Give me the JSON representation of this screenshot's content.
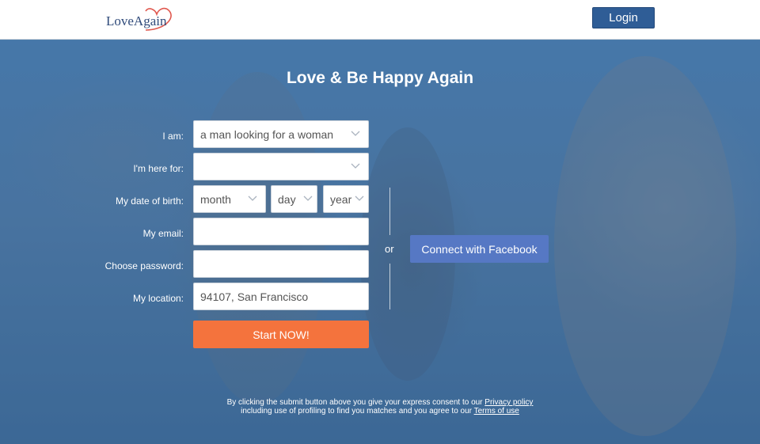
{
  "header": {
    "logo_text": "LoveAgain",
    "login_label": "Login"
  },
  "hero": {
    "headline": "Love & Be Happy Again"
  },
  "form": {
    "i_am": {
      "label": "I am:",
      "value": "a man looking for a woman"
    },
    "here_for": {
      "label": "I'm here for:",
      "value": ""
    },
    "dob": {
      "label": "My date of birth:",
      "month": "month",
      "day": "day",
      "year": "year"
    },
    "email": {
      "label": "My email:",
      "value": ""
    },
    "password": {
      "label": "Choose password:",
      "value": ""
    },
    "location": {
      "label": "My location:",
      "value": "94107, San Francisco"
    },
    "submit_label": "Start NOW!"
  },
  "social": {
    "or_text": "or",
    "facebook_label": "Connect with Facebook"
  },
  "consent": {
    "line1_prefix": "By clicking the submit button above you give your express consent to our ",
    "privacy_link": "Privacy policy",
    "line2_prefix": "including use of profiling to find you matches and you agree to our ",
    "terms_link": "Terms of use"
  },
  "colors": {
    "brand_blue": "#2f5d96",
    "cta_orange": "#f4733d",
    "facebook_blue": "#5678c4"
  }
}
